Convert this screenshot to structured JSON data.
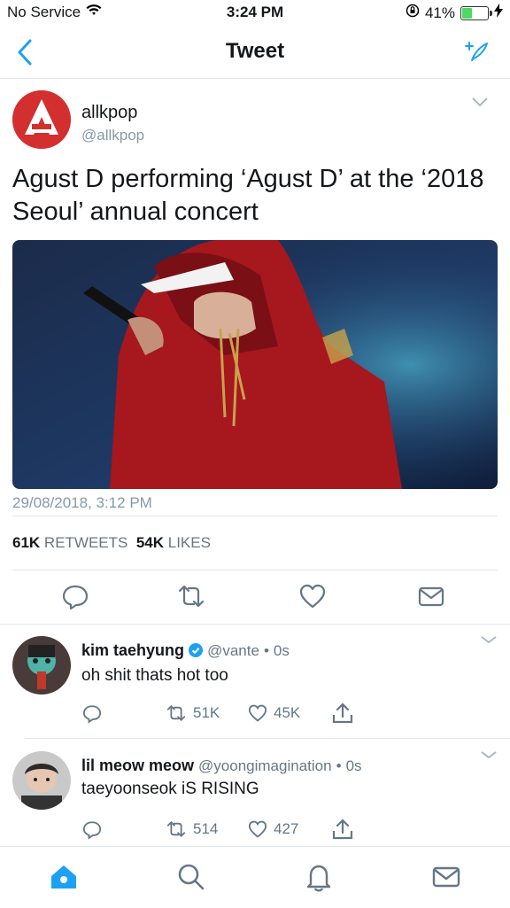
{
  "status_bar": {
    "carrier": "No Service",
    "time": "3:24 PM",
    "battery_percent": "41%",
    "battery_level": 0.41
  },
  "nav": {
    "title": "Tweet"
  },
  "tweet": {
    "author_name": "allkpop",
    "author_handle": "@allkpop",
    "text": "Agust D performing ‘Agust D’ at the ‘2018 Seoul’ annual concert",
    "timestamp": "29/08/2018, 3:12 PM",
    "retweets_count": "61K",
    "retweets_label": "RETWEETS",
    "likes_count": "54K",
    "likes_label": "LIKES"
  },
  "replies": [
    {
      "name": "kim taehyung",
      "verified": true,
      "handle": "@vante",
      "time": "0s",
      "text": "oh shit thats hot too",
      "retweets": "51K",
      "likes": "45K"
    },
    {
      "name": "lil meow meow",
      "verified": false,
      "handle": "@yoongimagination",
      "time": "0s",
      "text": "taeyoonseok iS RISING",
      "retweets": "514",
      "likes": "427"
    }
  ],
  "colors": {
    "accent": "#1da1f2",
    "secondary_text": "#657786",
    "divider": "#e1e8ed",
    "verified": "#1da1f2",
    "battery": "#4cd964"
  },
  "icons": [
    "wifi-icon",
    "orientation-lock-icon",
    "battery-icon",
    "charging-icon",
    "back-icon",
    "compose-icon",
    "reply-icon",
    "retweet-icon",
    "like-icon",
    "share-icon",
    "home-icon",
    "search-icon",
    "notifications-icon",
    "messages-icon"
  ]
}
